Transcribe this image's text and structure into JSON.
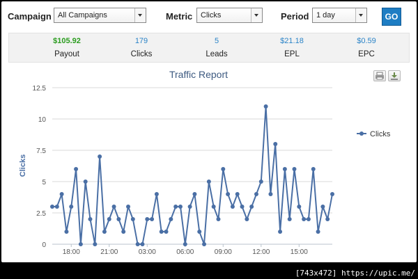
{
  "controls": {
    "campaign_label": "Campaign",
    "campaign_value": "All Campaigns",
    "metric_label": "Metric",
    "metric_value": "Clicks",
    "period_label": "Period",
    "period_value": "1 day",
    "go_label": "GO"
  },
  "stats": [
    {
      "value": "$105.92",
      "label": "Payout"
    },
    {
      "value": "179",
      "label": "Clicks"
    },
    {
      "value": "5",
      "label": "Leads"
    },
    {
      "value": "$21.18",
      "label": "EPL"
    },
    {
      "value": "$0.59",
      "label": "EPC"
    }
  ],
  "toolbar": {
    "print_icon": "printer-icon",
    "export_icon": "download-icon"
  },
  "colors": {
    "series": "#4a6fa5",
    "payout": "#2a9c1e",
    "stat_value": "#2a83c7",
    "go": "#1e7dc3"
  },
  "chart_data": {
    "type": "line",
    "title": "Traffic Report",
    "xlabel": "",
    "ylabel": "Clicks",
    "ylim": [
      0,
      12.5
    ],
    "y_ticks": [
      "0",
      "2.5",
      "5",
      "7.5",
      "10",
      "12.5"
    ],
    "x_ticks": [
      "18:00",
      "21:00",
      "03:00",
      "06:00",
      "09:00",
      "12:00",
      "15:00"
    ],
    "grid": true,
    "legend": "right",
    "series": [
      {
        "name": "Clicks",
        "values": [
          3,
          3,
          4,
          1,
          3,
          6,
          0,
          5,
          2,
          0,
          7,
          1,
          2,
          3,
          2,
          1,
          3,
          2,
          0,
          0,
          2,
          2,
          4,
          1,
          1,
          2,
          3,
          3,
          0,
          3,
          4,
          1,
          0,
          5,
          3,
          2,
          6,
          4,
          3,
          4,
          3,
          2,
          3,
          4,
          5,
          11,
          4,
          8,
          1,
          6,
          2,
          6,
          3,
          2,
          2,
          6,
          1,
          3,
          2,
          4
        ]
      }
    ]
  },
  "watermark": "[743x472] https://upic.me/"
}
